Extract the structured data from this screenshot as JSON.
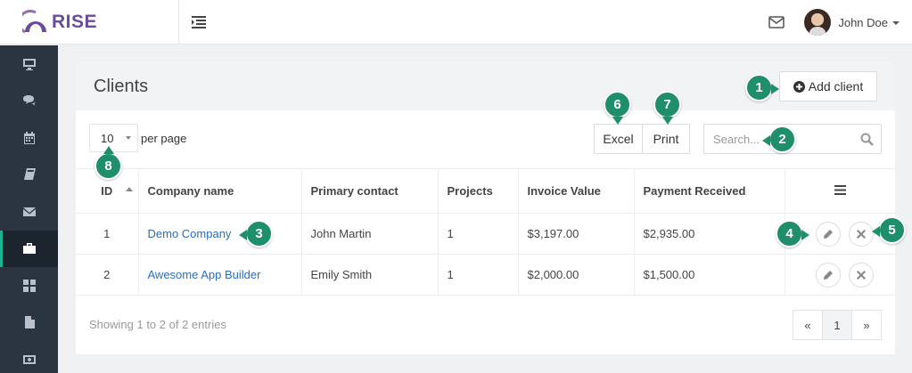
{
  "app": {
    "brand": "RISE",
    "brand_color": "#6b4c9a",
    "accent_color": "#1ab394",
    "link_color": "#2a6ebb",
    "badge_color": "#1f8e6a"
  },
  "header": {
    "user_name": "John Doe",
    "icons": [
      "menu-toggle-icon",
      "mail-icon",
      "avatar",
      "caret-down-icon"
    ]
  },
  "sidebar": {
    "items": [
      {
        "icon": "monitor-icon",
        "active": false
      },
      {
        "icon": "chat-icon",
        "active": false
      },
      {
        "icon": "calendar-icon",
        "active": false
      },
      {
        "icon": "book-icon",
        "active": false
      },
      {
        "icon": "envelope-icon",
        "active": false
      },
      {
        "icon": "briefcase-icon",
        "active": true
      },
      {
        "icon": "grid-icon",
        "active": false
      },
      {
        "icon": "document-icon",
        "active": false
      },
      {
        "icon": "money-icon",
        "active": false
      }
    ]
  },
  "panel": {
    "title": "Clients",
    "add_button": "Add client",
    "per_page": {
      "value": "10",
      "label": "per page"
    },
    "export": {
      "excel": "Excel",
      "print": "Print"
    },
    "search": {
      "placeholder": "Search..."
    },
    "columns": [
      "ID",
      "Company name",
      "Primary contact",
      "Projects",
      "Invoice Value",
      "Payment Received"
    ],
    "rows": [
      {
        "id": "1",
        "company": "Demo Company",
        "contact": "John Martin",
        "projects": "1",
        "invoice": "$3,197.00",
        "payment": "$2,935.00"
      },
      {
        "id": "2",
        "company": "Awesome App Builder",
        "contact": "Emily Smith",
        "projects": "1",
        "invoice": "$2,000.00",
        "payment": "$1,500.00"
      }
    ],
    "footer": "Showing 1 to 2 of 2 entries",
    "pagination": {
      "prev": "«",
      "current": "1",
      "next": "»"
    }
  },
  "annotations": [
    "1",
    "2",
    "3",
    "4",
    "5",
    "6",
    "7",
    "8"
  ]
}
